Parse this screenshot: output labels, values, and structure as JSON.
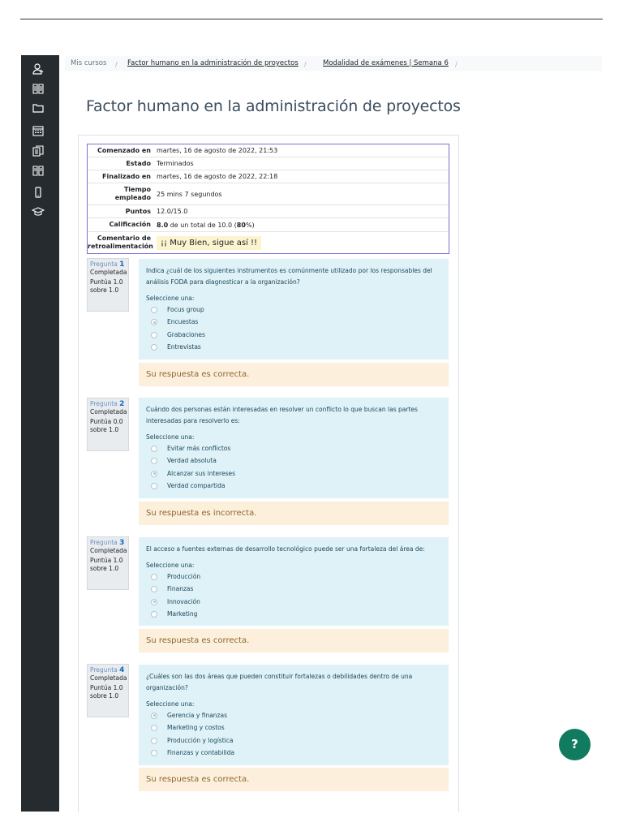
{
  "breadcrumb": [
    {
      "label": "Mis cursos",
      "link": false
    },
    {
      "label": "Factor humano en la administración de proyectos",
      "link": true
    },
    {
      "label": "Modalidad de exámenes | Semana 6",
      "link": true
    }
  ],
  "page_title": "Factor humano en la administración de proyectos",
  "summary": {
    "rows": [
      {
        "label": "Comenzado en",
        "value": "martes, 16 de agosto de 2022, 21:53"
      },
      {
        "label": "Estado",
        "value": "Terminados"
      },
      {
        "label": "Finalizado en",
        "value": "martes, 16 de agosto de 2022, 22:18"
      },
      {
        "label": "Tiempo empleado",
        "value": "25 mins 7 segundos"
      },
      {
        "label": "Puntos",
        "value": "12.0/15.0"
      }
    ],
    "grade_label": "Calificación",
    "grade_value": "8.0",
    "grade_suffix": " de un total de 10.0 (",
    "grade_percent": "80",
    "grade_end": "%)",
    "feedback_label": "Comentario de retroalimentación",
    "feedback_value": "¡¡ Muy Bien, sigue así !!"
  },
  "questions": [
    {
      "label": "Pregunta",
      "number": "1",
      "state": "Completada",
      "points": "Puntúa 1.0 sobre 1.0",
      "text": "Indica ¿cuál de los siguientes instrumentos es comúnmente utilizado por los responsables del análisis FODA para diagnosticar a la organización?",
      "prompt": "Seleccione una:",
      "options": [
        "Focus group",
        "Encuestas",
        "Grabaciones",
        "Entrevistas"
      ],
      "selected": 1,
      "feedback": "Su respuesta es correcta."
    },
    {
      "label": "Pregunta",
      "number": "2",
      "state": "Completada",
      "points": "Puntúa 0.0 sobre 1.0",
      "text": "Cuándo dos personas están interesadas en resolver un conflicto lo que buscan las partes interesadas para resolverlo es:",
      "prompt": "Seleccione una:",
      "options": [
        "Evitar más conflictos",
        "Verdad absoluta",
        "Alcanzar sus intereses",
        "Verdad compartida"
      ],
      "selected": 2,
      "feedback": "Su respuesta es incorrecta."
    },
    {
      "label": "Pregunta",
      "number": "3",
      "state": "Completada",
      "points": "Puntúa 1.0 sobre 1.0",
      "text": "El acceso a fuentes externas de desarrollo tecnológico puede ser una fortaleza del área de:",
      "prompt": "Seleccione una:",
      "options": [
        "Producción",
        "Finanzas",
        "Innovación",
        "Marketing"
      ],
      "selected": 2,
      "feedback": "Su respuesta es correcta."
    },
    {
      "label": "Pregunta",
      "number": "4",
      "state": "Completada",
      "points": "Puntúa 1.0 sobre 1.0",
      "text": "¿Cuáles son las dos áreas que pueden constituir fortalezas o debilidades dentro de una organización?",
      "prompt": "Seleccione una:",
      "options": [
        "Gerencia y finanzas",
        "Marketing y costos",
        "Producción y logística",
        "Finanzas y contabilida"
      ],
      "selected": 0,
      "feedback": "Su respuesta es correcta."
    }
  ],
  "sidebar_icons": [
    "user-icon",
    "book-icon",
    "folder-icon",
    "calendar-icon",
    "copy-icon",
    "book-open-icon",
    "mobile-icon",
    "graduation-cap-icon"
  ],
  "help_button": {
    "label": "?",
    "color": "#117b5f"
  }
}
